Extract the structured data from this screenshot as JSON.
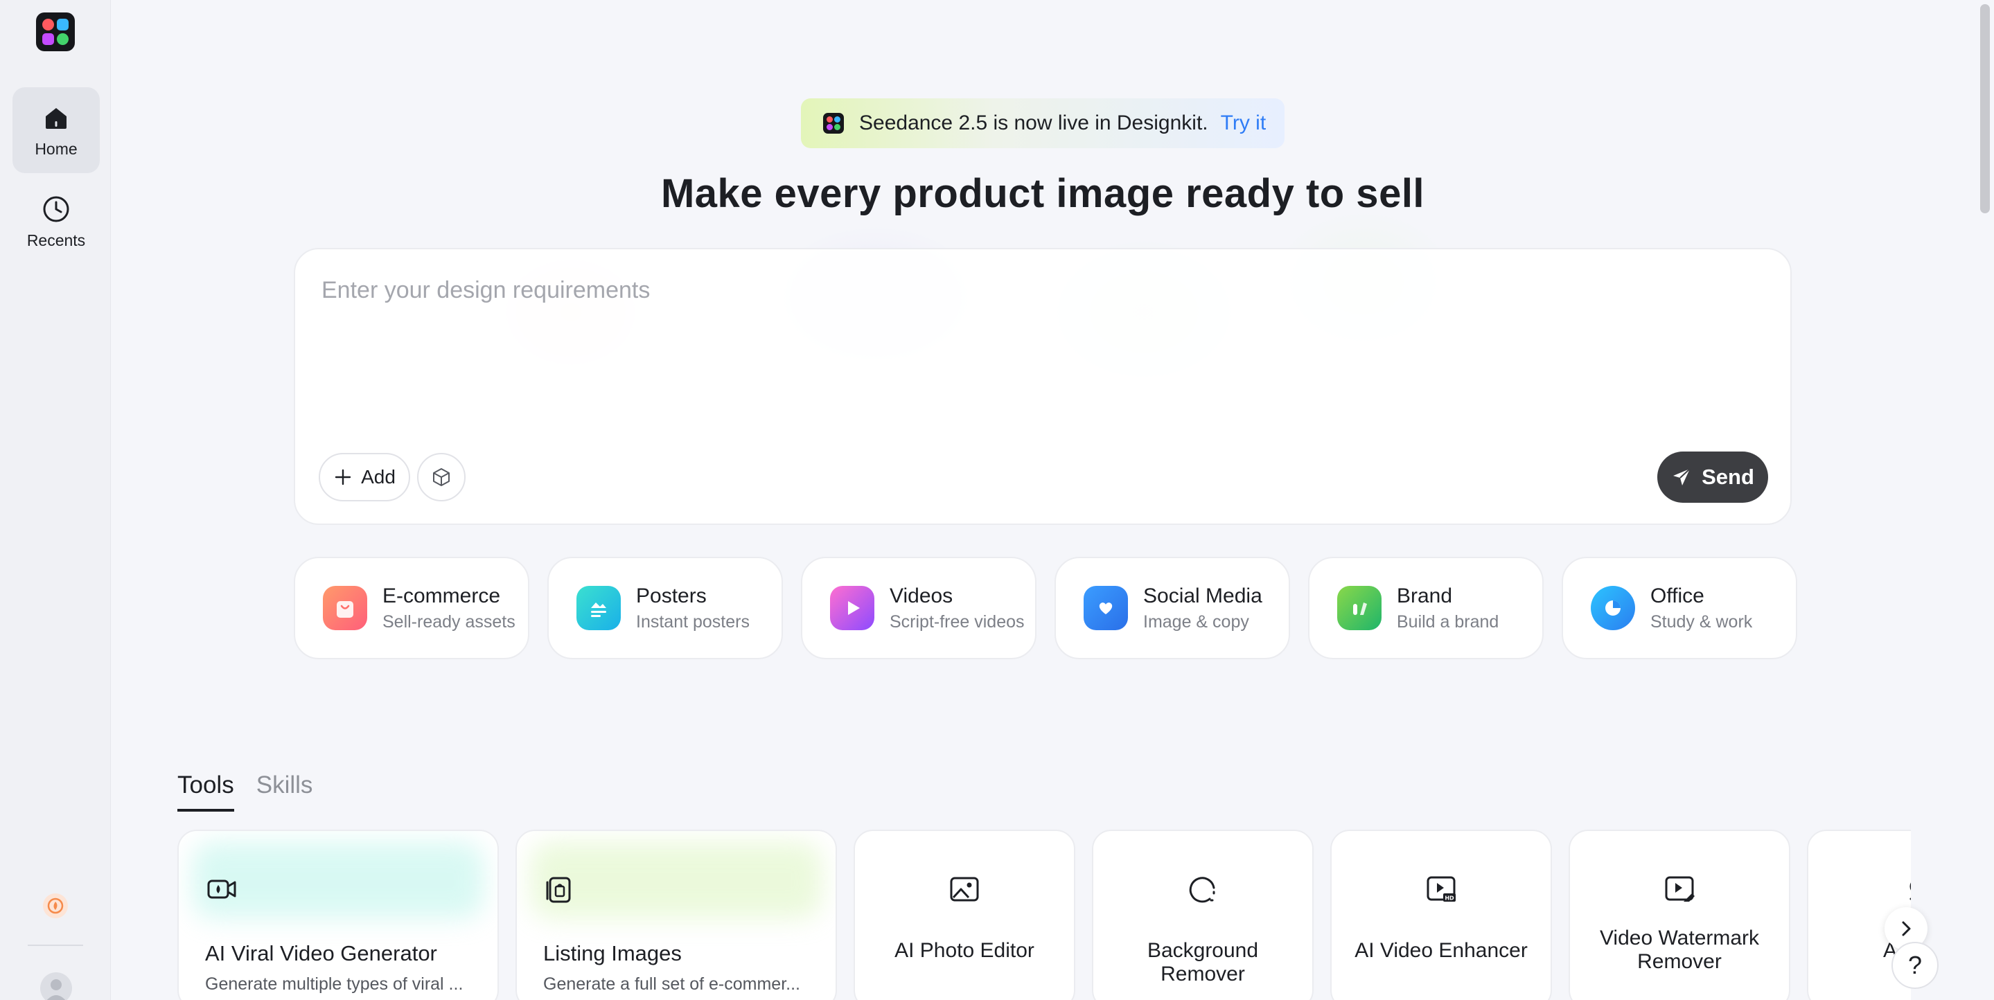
{
  "sidebar": {
    "items": [
      {
        "label": "Home",
        "icon": "home-icon",
        "active": true
      },
      {
        "label": "Recents",
        "icon": "clock-icon",
        "active": false
      }
    ]
  },
  "banner": {
    "text": "Seedance 2.5 is now live in Designkit.",
    "cta": "Try it"
  },
  "headline": "Make every product image ready to sell",
  "prompt": {
    "placeholder": "Enter your design requirements",
    "add_label": "Add",
    "send_label": "Send"
  },
  "categories": [
    {
      "title": "E-commerce",
      "subtitle": "Sell-ready assets",
      "color": "#ff7a59"
    },
    {
      "title": "Posters",
      "subtitle": "Instant posters",
      "color": "#1fc8d8"
    },
    {
      "title": "Videos",
      "subtitle": "Script-free videos",
      "color": "#d452f0"
    },
    {
      "title": "Social Media",
      "subtitle": "Image & copy",
      "color": "#2f86f6"
    },
    {
      "title": "Brand",
      "subtitle": "Build a brand",
      "color": "#3cc36a"
    },
    {
      "title": "Office",
      "subtitle": "Study & work",
      "color": "#1aa2ff"
    }
  ],
  "tabs": [
    {
      "label": "Tools",
      "active": true
    },
    {
      "label": "Skills",
      "active": false
    }
  ],
  "tools": [
    {
      "name": "AI Viral Video Generator",
      "desc": "Generate multiple types of viral ...",
      "icon": "video-camera-icon"
    },
    {
      "name": "Listing Images",
      "desc": "Generate a full set of e-commer...",
      "icon": "listing-image-icon"
    },
    {
      "name": "AI Photo Editor",
      "icon": "photo-icon"
    },
    {
      "name": "Background Remover",
      "icon": "background-remove-icon"
    },
    {
      "name": "AI Video Enhancer",
      "icon": "video-hd-icon"
    },
    {
      "name": "Video Watermark Remover",
      "icon": "video-erase-icon"
    },
    {
      "name": "AI Obje",
      "icon": "object-icon"
    }
  ],
  "help_label": "?"
}
